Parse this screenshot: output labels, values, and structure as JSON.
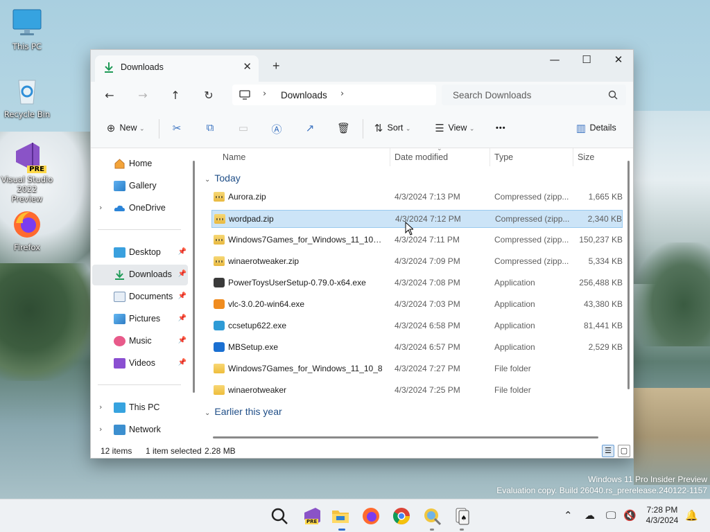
{
  "desktop": {
    "icons": [
      {
        "label": "This PC"
      },
      {
        "label": "Recycle Bin"
      },
      {
        "label": "Visual Studio 2022 Preview",
        "badge": "PRE"
      },
      {
        "label": "Firefox"
      }
    ],
    "watermark": {
      "line1": "Windows 11 Pro Insider Preview",
      "line2": "Evaluation copy. Build 26040.rs_prerelease.240122-1157"
    }
  },
  "window": {
    "tab_title": "Downloads",
    "tab_close": "✕",
    "new_tab": "+",
    "minimize": "—",
    "maximize": "☐",
    "close": "✕",
    "nav": {
      "back": "←",
      "forward": "→",
      "up": "↑",
      "refresh": "↻",
      "breadcrumb_sep": "›",
      "crumb": "Downloads",
      "trailing_chev": "›"
    },
    "search_placeholder": "Search Downloads",
    "toolbar": {
      "new_label": "New",
      "sort_label": "Sort",
      "view_label": "View",
      "more": "•••",
      "details_label": "Details"
    },
    "sidebar": {
      "items": [
        {
          "label": "Home",
          "icon": "home-icon"
        },
        {
          "label": "Gallery",
          "icon": "gallery-icon"
        },
        {
          "label": "OneDrive",
          "icon": "onedrive-icon",
          "expandable": true
        },
        {
          "label": "Desktop",
          "icon": "desktop-icon",
          "pinned": true
        },
        {
          "label": "Downloads",
          "icon": "downloads-icon",
          "pinned": true,
          "selected": true
        },
        {
          "label": "Documents",
          "icon": "documents-icon",
          "pinned": true
        },
        {
          "label": "Pictures",
          "icon": "pictures-icon",
          "pinned": true
        },
        {
          "label": "Music",
          "icon": "music-icon",
          "pinned": true
        },
        {
          "label": "Videos",
          "icon": "videos-icon",
          "pinned": true
        },
        {
          "label": "This PC",
          "icon": "this-pc-icon",
          "expandable": true
        },
        {
          "label": "Network",
          "icon": "network-icon",
          "expandable": true
        }
      ],
      "expand_glyph": "›",
      "pin_glyph": "📌"
    },
    "columns": {
      "name": "Name",
      "date": "Date modified",
      "type": "Type",
      "size": "Size"
    },
    "groups": [
      {
        "label": "Today",
        "files": [
          {
            "name": "Aurora.zip",
            "date": "4/3/2024 7:13 PM",
            "type": "Compressed (zipp...",
            "size": "1,665 KB",
            "kind": "zip"
          },
          {
            "name": "wordpad.zip",
            "date": "4/3/2024 7:12 PM",
            "type": "Compressed (zipp...",
            "size": "2,340 KB",
            "kind": "zip",
            "selected": true
          },
          {
            "name": "Windows7Games_for_Windows_11_10_8....",
            "date": "4/3/2024 7:11 PM",
            "type": "Compressed (zipp...",
            "size": "150,237 KB",
            "kind": "zip"
          },
          {
            "name": "winaerotweaker.zip",
            "date": "4/3/2024 7:09 PM",
            "type": "Compressed (zipp...",
            "size": "5,334 KB",
            "kind": "zip"
          },
          {
            "name": "PowerToysUserSetup-0.79.0-x64.exe",
            "date": "4/3/2024 7:08 PM",
            "type": "Application",
            "size": "256,488 KB",
            "kind": "exe-powertoys"
          },
          {
            "name": "vlc-3.0.20-win64.exe",
            "date": "4/3/2024 7:03 PM",
            "type": "Application",
            "size": "43,380 KB",
            "kind": "exe-vlc"
          },
          {
            "name": "ccsetup622.exe",
            "date": "4/3/2024 6:58 PM",
            "type": "Application",
            "size": "81,441 KB",
            "kind": "exe-ccleaner"
          },
          {
            "name": "MBSetup.exe",
            "date": "4/3/2024 6:57 PM",
            "type": "Application",
            "size": "2,529 KB",
            "kind": "exe-mb"
          },
          {
            "name": "Windows7Games_for_Windows_11_10_8",
            "date": "4/3/2024 7:27 PM",
            "type": "File folder",
            "size": "",
            "kind": "folder"
          },
          {
            "name": "winaerotweaker",
            "date": "4/3/2024 7:25 PM",
            "type": "File folder",
            "size": "",
            "kind": "folder"
          }
        ]
      },
      {
        "label": "Earlier this year",
        "files": []
      }
    ],
    "status": {
      "count": "12 items",
      "selection": "1 item selected",
      "size": "2.28 MB"
    }
  },
  "taskbar": {
    "clock_time": "7:28 PM",
    "clock_date": "4/3/2024",
    "apps": [
      "search-icon",
      "visual-studio-preview-icon",
      "file-explorer-icon",
      "firefox-icon",
      "chrome-icon",
      "winaero-tweaker-icon",
      "solitaire-icon"
    ],
    "tray": [
      "show-hidden-icons",
      "onedrive-tray-icon",
      "network-icon",
      "volume-muted-icon",
      "notification-bell-icon"
    ],
    "vs_badge": "PRE"
  }
}
